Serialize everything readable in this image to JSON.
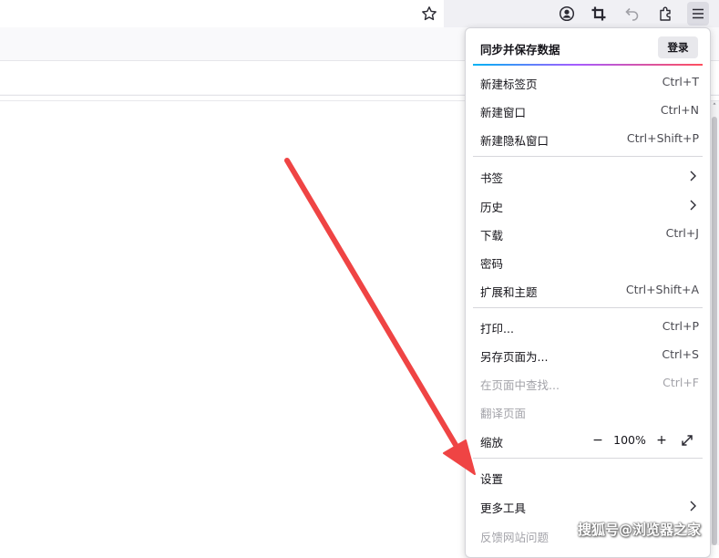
{
  "menu": {
    "sync": {
      "title": "同步并保存数据",
      "login_label": "登录"
    },
    "group1": [
      {
        "label": "新建标签页",
        "shortcut": "Ctrl+T"
      },
      {
        "label": "新建窗口",
        "shortcut": "Ctrl+N"
      },
      {
        "label": "新建隐私窗口",
        "shortcut": "Ctrl+Shift+P"
      }
    ],
    "group2": [
      {
        "label": "书签",
        "submenu": true
      },
      {
        "label": "历史",
        "submenu": true
      },
      {
        "label": "下载",
        "shortcut": "Ctrl+J"
      },
      {
        "label": "密码"
      },
      {
        "label": "扩展和主题",
        "shortcut": "Ctrl+Shift+A"
      }
    ],
    "group3": [
      {
        "label": "打印...",
        "shortcut": "Ctrl+P"
      },
      {
        "label": "另存页面为...",
        "shortcut": "Ctrl+S"
      },
      {
        "label": "在页面中查找...",
        "shortcut": "Ctrl+F",
        "disabled": true
      },
      {
        "label": "翻译页面",
        "disabled": true
      }
    ],
    "zoom": {
      "label": "缩放",
      "minus": "−",
      "value": "100%",
      "plus": "+"
    },
    "group4": [
      {
        "label": "设置"
      },
      {
        "label": "更多工具",
        "submenu": true
      },
      {
        "label": "反馈网站问题",
        "disabled": true
      }
    ]
  },
  "toolbar": {
    "icons": [
      "bookmark-star-icon",
      "account-icon",
      "screenshot-icon",
      "undo-icon",
      "extensions-icon",
      "app-menu-icon"
    ]
  },
  "annotation": {
    "arrow_color": "#ef4444"
  },
  "watermark": "搜狐号@浏览器之家"
}
